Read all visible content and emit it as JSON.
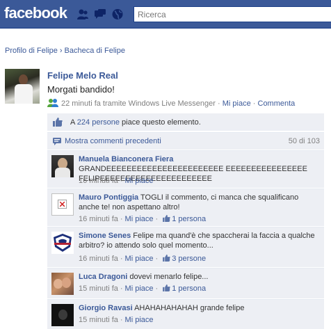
{
  "header": {
    "logo": "facebook",
    "search_placeholder": "Ricerca"
  },
  "breadcrumb": {
    "profile": "Profilo di Felipe",
    "separator": "›",
    "wall": "Bacheca di Felipe"
  },
  "post": {
    "author": "Felipe Melo Real",
    "message": "Morgati bandido!",
    "time": "22 minuti fa tramite Windows Live Messenger",
    "like_link": "Mi piace",
    "comment_link": "Commenta",
    "dot": "·"
  },
  "likes": {
    "prefix": "A ",
    "people_link": "224 persone",
    "suffix": " piace questo elemento."
  },
  "more_comments": {
    "label": "Mostra commenti precedenti",
    "count": "50 di 103"
  },
  "comments": [
    {
      "name": "Manuela Bianconera Fiera",
      "text": "GRANDEEEEEEEEEEEEEEEEEEEEEEE EEEEEEEEEEEEEEEE FELIPEEEEEEEEEEEEEEEEEEEEEE",
      "time": "16 minuti fa",
      "like_link": "Mi piace",
      "likes": ""
    },
    {
      "name": "Mauro Pontiggia",
      "text": "TOGLI il commento, ci manca che squalificano anche te! non aspettano altro!",
      "time": "16 minuti fa",
      "like_link": "Mi piace",
      "likes": "1 persona"
    },
    {
      "name": "Simone Senes",
      "text": "Felipe ma quand'è che spaccherai la faccia a qualche arbitro? io attendo solo quel momento...",
      "time": "16 minuti fa",
      "like_link": "Mi piace",
      "likes": "3 persone"
    },
    {
      "name": "Luca Dragoni",
      "text": "dovevi menarlo felipe...",
      "time": "15 minuti fa",
      "like_link": "Mi piace",
      "likes": "1 persona"
    },
    {
      "name": "Giorgio Ravasi",
      "text": "AHAHAHAHAHAH grande felipe",
      "time": "15 minuti fa",
      "like_link": "Mi piace",
      "likes": ""
    }
  ],
  "colors": {
    "brand": "#3b5998",
    "feedback_bg": "#edeff4",
    "meta": "#808080"
  }
}
